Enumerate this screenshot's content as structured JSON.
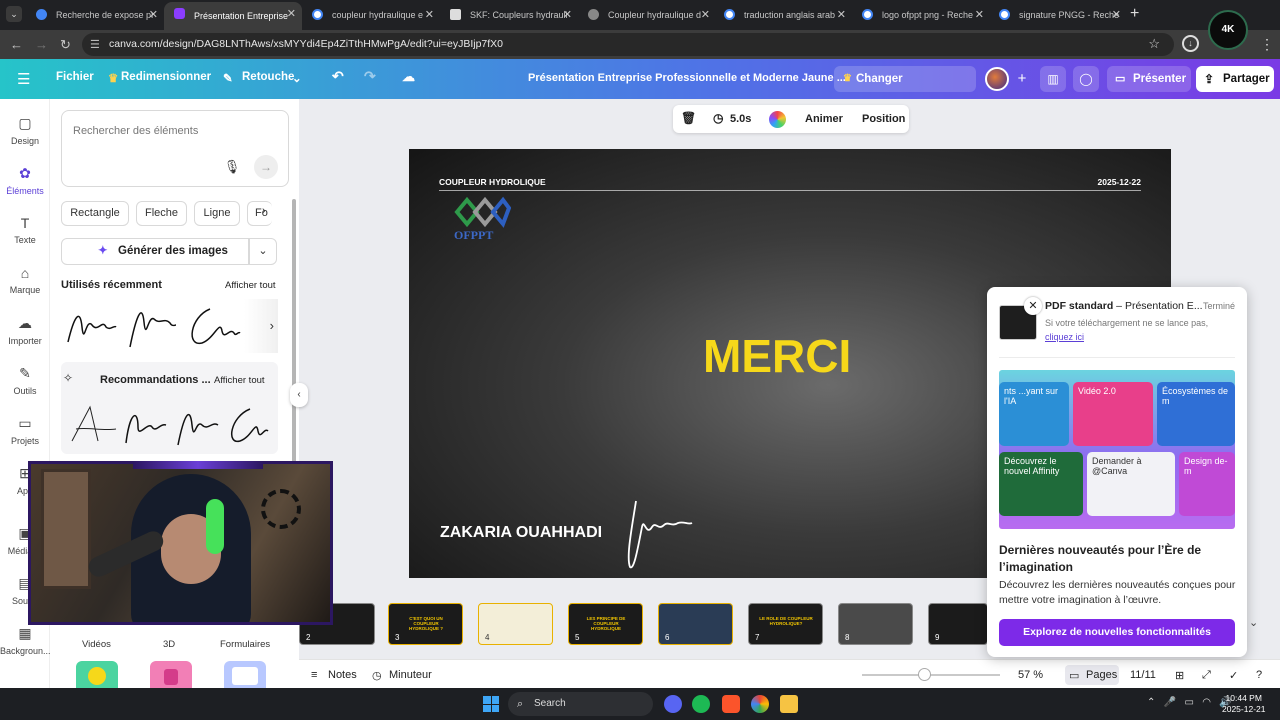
{
  "browser": {
    "tabs": [
      {
        "title": "Recherche de expose pr",
        "active": false,
        "color": "#4285f4"
      },
      {
        "title": "Présentation Entreprise",
        "active": true,
        "color": "#8b3dff"
      },
      {
        "title": "coupleur hydraulique e",
        "active": false,
        "color": "#ffffff"
      },
      {
        "title": "SKF: Coupleurs hydrauli",
        "active": false,
        "color": "#ffffff"
      },
      {
        "title": "Coupleur hydraulique d",
        "active": false,
        "color": "#ffffff"
      },
      {
        "title": "traduction anglais arab",
        "active": false,
        "color": "#ffffff"
      },
      {
        "title": "logo ofppt png - Reche",
        "active": false,
        "color": "#ffffff"
      },
      {
        "title": "signature PNGG - Reche",
        "active": false,
        "color": "#ffffff"
      }
    ],
    "url": "canva.com/design/DAG8LNThAws/xsMYYdi4Ep4ZiTthHMwPgA/edit?ui=eyJBIjp7fX0",
    "profile_badge": "4K"
  },
  "canva_top": {
    "file": "Fichier",
    "resize": "Redimensionner",
    "retouch": "Retouche",
    "doc_title": "Présentation Entreprise Professionnelle et Moderne Jaune ...",
    "upgrade": "Changer d’abonnement",
    "present": "Présenter",
    "share": "Partager"
  },
  "rail": [
    {
      "label": "Design",
      "icon": "design-icon",
      "glyph": "▢"
    },
    {
      "label": "Éléments",
      "icon": "elements-icon",
      "glyph": "✿"
    },
    {
      "label": "Texte",
      "icon": "text-icon",
      "glyph": "T"
    },
    {
      "label": "Marque",
      "icon": "brand-icon",
      "glyph": "⌂"
    },
    {
      "label": "Importer",
      "icon": "upload-icon",
      "glyph": "☁"
    },
    {
      "label": "Outils",
      "icon": "tools-icon",
      "glyph": "✎"
    },
    {
      "label": "Projets",
      "icon": "projects-icon",
      "glyph": "▭"
    },
    {
      "label": "App",
      "icon": "apps-icon",
      "glyph": "⊞"
    },
    {
      "label": "Média m",
      "icon": "media-icon",
      "glyph": "▣"
    },
    {
      "label": "Sous-t",
      "icon": "subtitles-icon",
      "glyph": "▤"
    },
    {
      "label": "Backgroun...",
      "icon": "background-icon",
      "glyph": "▦"
    }
  ],
  "panel": {
    "search_placeholder": "Rechercher des éléments",
    "chips": [
      "Rectangle",
      "Fleche",
      "Ligne",
      "Fo"
    ],
    "generate": "Générer des images",
    "recent_title": "Utilisés récemment",
    "recent_link": "Afficher tout",
    "reco_title": "Recommandations ...",
    "reco_link": "Afficher tout",
    "bottom_tabs": [
      "Vidéos",
      "3D",
      "Formulaires"
    ]
  },
  "toolbar": {
    "duration": "5.0s",
    "animate": "Animer",
    "position": "Position"
  },
  "slide": {
    "header": "COUPLEUR HYDROLIQUE",
    "date": "2025-12-22",
    "logo_text": "OFPPT",
    "title": "MERCI",
    "author": "ZAKARIA OUAHHADI",
    "title_color": "#f6d81a"
  },
  "thumbnails": [
    {
      "num": "2",
      "caption": "",
      "selected": false
    },
    {
      "num": "3",
      "caption": "C'EST QUOI UN COUPLEUR HYDROLIQUE ?",
      "selected": true
    },
    {
      "num": "4",
      "caption": "",
      "selected": true
    },
    {
      "num": "5",
      "caption": "LES PRINCIPE DE COUPLEUR HYDROLIQUE",
      "selected": true
    },
    {
      "num": "6",
      "caption": "",
      "selected": true
    },
    {
      "num": "7",
      "caption": "LE ROLE DE COUPLEUR HYDROLIQUE?",
      "selected": false
    },
    {
      "num": "8",
      "caption": "",
      "selected": false
    },
    {
      "num": "9",
      "caption": "",
      "selected": false
    }
  ],
  "statusbar": {
    "notes": "Notes",
    "timer": "Minuteur",
    "zoom": "57 %",
    "zoom_level": 0.57,
    "pages": "Pages",
    "page_count": "11/11"
  },
  "popup": {
    "file_type": "PDF standard",
    "file_name": " – Présentation E...",
    "status": "Terminé",
    "message": "Si votre téléchargement ne se lance pas,",
    "link": "cliquez ici",
    "promo_cards": [
      "nts ...yant sur l'IA",
      "Vidéo 2.0",
      "Écosystèmes de m",
      "Découvrez le nouvel Affinity",
      "Demander à @Canva",
      "Design de-m"
    ],
    "heading": "Dernières nouveautés pour l’Ère de l’imagination",
    "description": "Découvrez les dernières nouveautés conçues pour mettre votre imagination à l’œuvre.",
    "cta": "Explorez de nouvelles fonctionnalités"
  },
  "taskbar": {
    "search": "Search",
    "time": "10:44 PM",
    "date": "2025-12-21"
  }
}
